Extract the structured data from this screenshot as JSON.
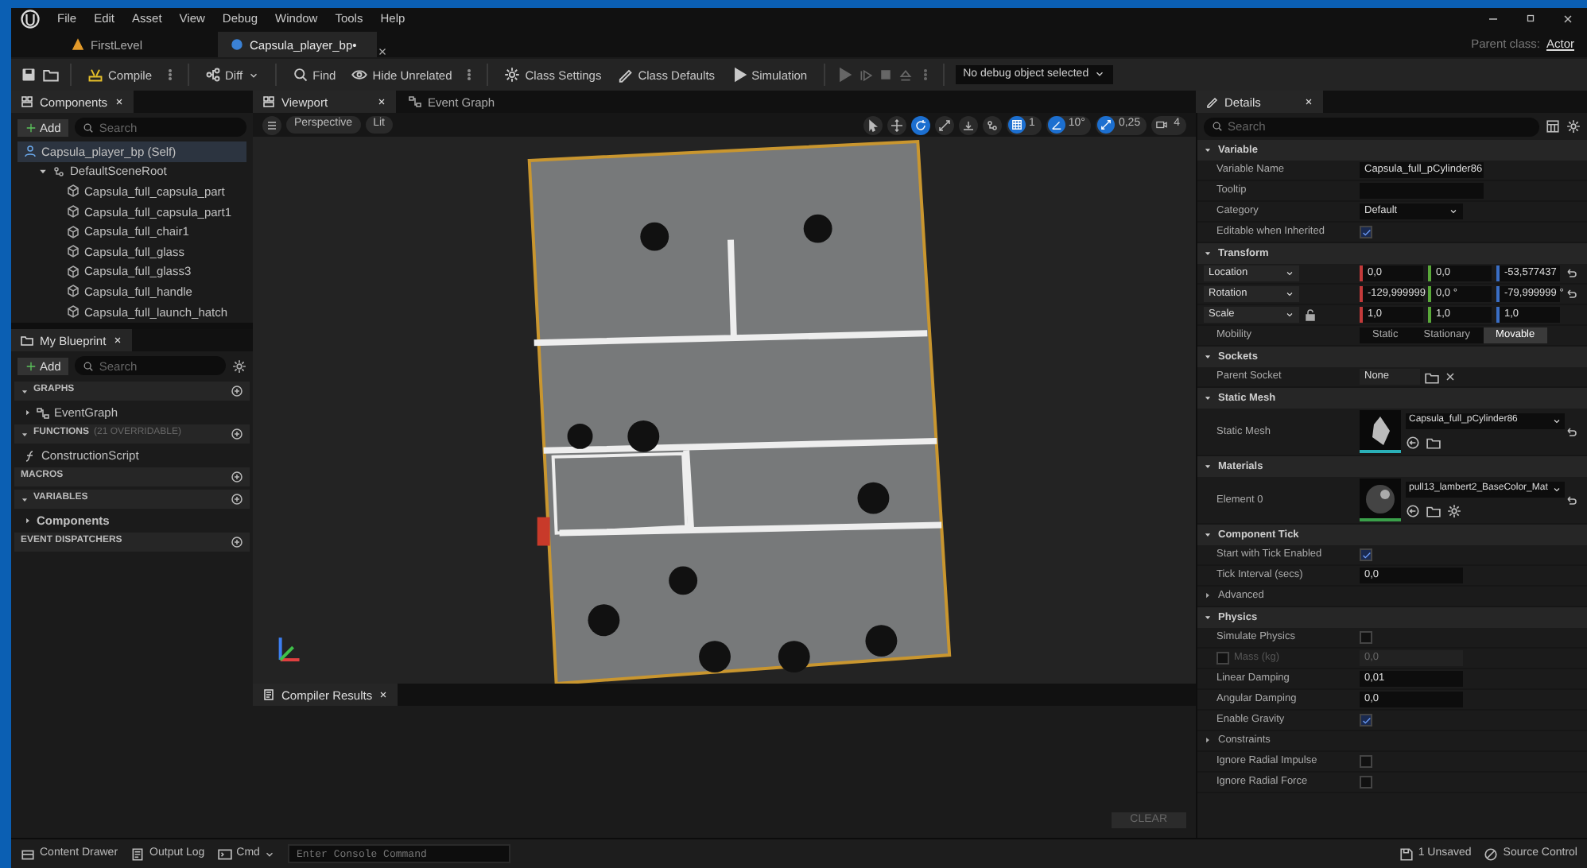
{
  "menu": [
    "File",
    "Edit",
    "Asset",
    "View",
    "Debug",
    "Window",
    "Tools",
    "Help"
  ],
  "doc_tabs": [
    {
      "label": "FirstLevel",
      "selected": false,
      "kind": "level"
    },
    {
      "label": "Capsula_player_bp•",
      "selected": true,
      "kind": "blueprint"
    }
  ],
  "parent_class": {
    "label": "Parent class:",
    "value": "Actor"
  },
  "toolbar": [
    "Compile",
    "Diff",
    "Find",
    "Hide Unrelated",
    "Class Settings",
    "Class Defaults",
    "Simulation"
  ],
  "debug_object": "No debug object selected",
  "components": {
    "title": "Components",
    "add": "Add",
    "search_placeholder": "Search",
    "tree": [
      {
        "label": "Capsula_player_bp (Self)",
        "kind": "actor",
        "selected": true,
        "children": [
          {
            "label": "DefaultSceneRoot",
            "kind": "scene",
            "selected": false,
            "expanded": true,
            "children": [
              {
                "label": "Capsula_full_capsula_part",
                "kind": "mesh",
                "selected": false
              },
              {
                "label": "Capsula_full_capsula_part1",
                "kind": "mesh",
                "selected": false
              },
              {
                "label": "Capsula_full_chair1",
                "kind": "mesh",
                "selected": false
              },
              {
                "label": "Capsula_full_glass",
                "kind": "mesh",
                "selected": false
              },
              {
                "label": "Capsula_full_glass3",
                "kind": "mesh",
                "selected": false
              },
              {
                "label": "Capsula_full_handle",
                "kind": "mesh",
                "selected": false
              },
              {
                "label": "Capsula_full_launch_hatch",
                "kind": "mesh",
                "selected": false
              }
            ]
          }
        ]
      }
    ]
  },
  "my_blueprint": {
    "title": "My Blueprint",
    "add": "Add",
    "search_placeholder": "Search",
    "sections": [
      {
        "label": "GRAPHS",
        "expanded": true,
        "items": [
          {
            "label": "EventGraph",
            "kind": "graph"
          }
        ]
      },
      {
        "label": "FUNCTIONS",
        "note": "(21 OVERRIDABLE)",
        "expanded": true,
        "items": [
          {
            "label": "ConstructionScript",
            "kind": "function"
          }
        ]
      },
      {
        "label": "MACROS",
        "expanded": false
      },
      {
        "label": "VARIABLES",
        "expanded": true,
        "items": [
          {
            "label": "Components",
            "kind": "category"
          }
        ]
      },
      {
        "label": "EVENT DISPATCHERS",
        "expanded": false
      }
    ]
  },
  "viewport": {
    "tabs": [
      {
        "label": "Viewport",
        "selected": true
      },
      {
        "label": "Event Graph",
        "selected": false
      }
    ],
    "view_mode": "Perspective",
    "lighting": "Lit",
    "transform_tools": [
      {
        "selected": false
      },
      {
        "selected": false
      },
      {
        "selected": true
      },
      {
        "selected": false
      }
    ],
    "snaps": [
      {
        "label": "1",
        "on": true,
        "kind": "grid"
      },
      {
        "label": "10°",
        "on": true,
        "kind": "angle"
      },
      {
        "label": "0,25",
        "on": true,
        "kind": "scale"
      }
    ],
    "camera_speed": "4"
  },
  "compiler": {
    "title": "Compiler Results",
    "clear": "CLEAR"
  },
  "details": {
    "title": "Details",
    "search_placeholder": "Search",
    "sections": [
      {
        "title": "Variable",
        "rows": [
          {
            "kind": "text",
            "label": "Variable Name",
            "value": "Capsula_full_pCylinder86",
            "disabled": false
          },
          {
            "kind": "text",
            "label": "Tooltip",
            "disabled": false
          },
          {
            "kind": "dropdown",
            "label": "Category",
            "value": "Default"
          },
          {
            "kind": "checkbox",
            "label": "Editable when Inherited",
            "checked": true
          }
        ]
      },
      {
        "title": "Transform",
        "rows": [
          {
            "kind": "vector",
            "label": "Location",
            "values": [
              "0,0",
              "0,0",
              "-53,577437"
            ],
            "reset": true
          },
          {
            "kind": "vector",
            "label": "Rotation",
            "values": [
              "-129,999999",
              "0,0 °",
              "-79,999999 °"
            ],
            "reset": true
          },
          {
            "kind": "vector",
            "label": "Scale",
            "values": [
              "1,0",
              "1,0",
              "1,0"
            ],
            "reset": false,
            "lock": true
          },
          {
            "kind": "segmented",
            "label": "Mobility",
            "options": [
              {
                "label": "Static",
                "selected": false
              },
              {
                "label": "Stationary",
                "selected": false
              },
              {
                "label": "Movable",
                "selected": true
              }
            ]
          }
        ]
      },
      {
        "title": "Sockets",
        "rows": [
          {
            "kind": "socket",
            "label": "Parent Socket",
            "value": "None"
          }
        ]
      },
      {
        "title": "Static Mesh",
        "rows": [
          {
            "kind": "mesh_asset",
            "label": "Static Mesh",
            "value": "Capsula_full_pCylinder86",
            "reset": true
          }
        ]
      },
      {
        "title": "Materials",
        "rows": [
          {
            "kind": "material_asset",
            "label": "Element 0",
            "value": "pull13_lambert2_BaseColor_Mat",
            "reset": true
          }
        ]
      },
      {
        "title": "Component Tick",
        "rows": [
          {
            "kind": "checkbox",
            "label": "Start with Tick Enabled",
            "checked": true
          },
          {
            "kind": "text",
            "label": "Tick Interval (secs)",
            "value": "0,0",
            "disabled": false
          },
          {
            "kind": "group",
            "label": "Advanced"
          }
        ]
      },
      {
        "title": "Physics",
        "rows": [
          {
            "kind": "checkbox",
            "label": "Simulate Physics",
            "checked": false
          },
          {
            "kind": "override",
            "label": "Mass (kg)",
            "value": "0,0",
            "disabled": true,
            "checked": false
          },
          {
            "kind": "text",
            "label": "Linear Damping",
            "value": "0,01",
            "disabled": false
          },
          {
            "kind": "text",
            "label": "Angular Damping",
            "value": "0,0",
            "disabled": false
          },
          {
            "kind": "checkbox",
            "label": "Enable Gravity",
            "checked": true
          },
          {
            "kind": "group",
            "label": "Constraints"
          },
          {
            "kind": "checkbox",
            "label": "Ignore Radial Impulse",
            "checked": false
          },
          {
            "kind": "checkbox",
            "label": "Ignore Radial Force",
            "checked": false
          }
        ]
      }
    ]
  },
  "status_bar": {
    "content_drawer": "Content Drawer",
    "output_log": "Output Log",
    "cmd": "Cmd",
    "console_placeholder": "Enter Console Command",
    "unsaved": "1 Unsaved",
    "source_control": "Source Control"
  }
}
